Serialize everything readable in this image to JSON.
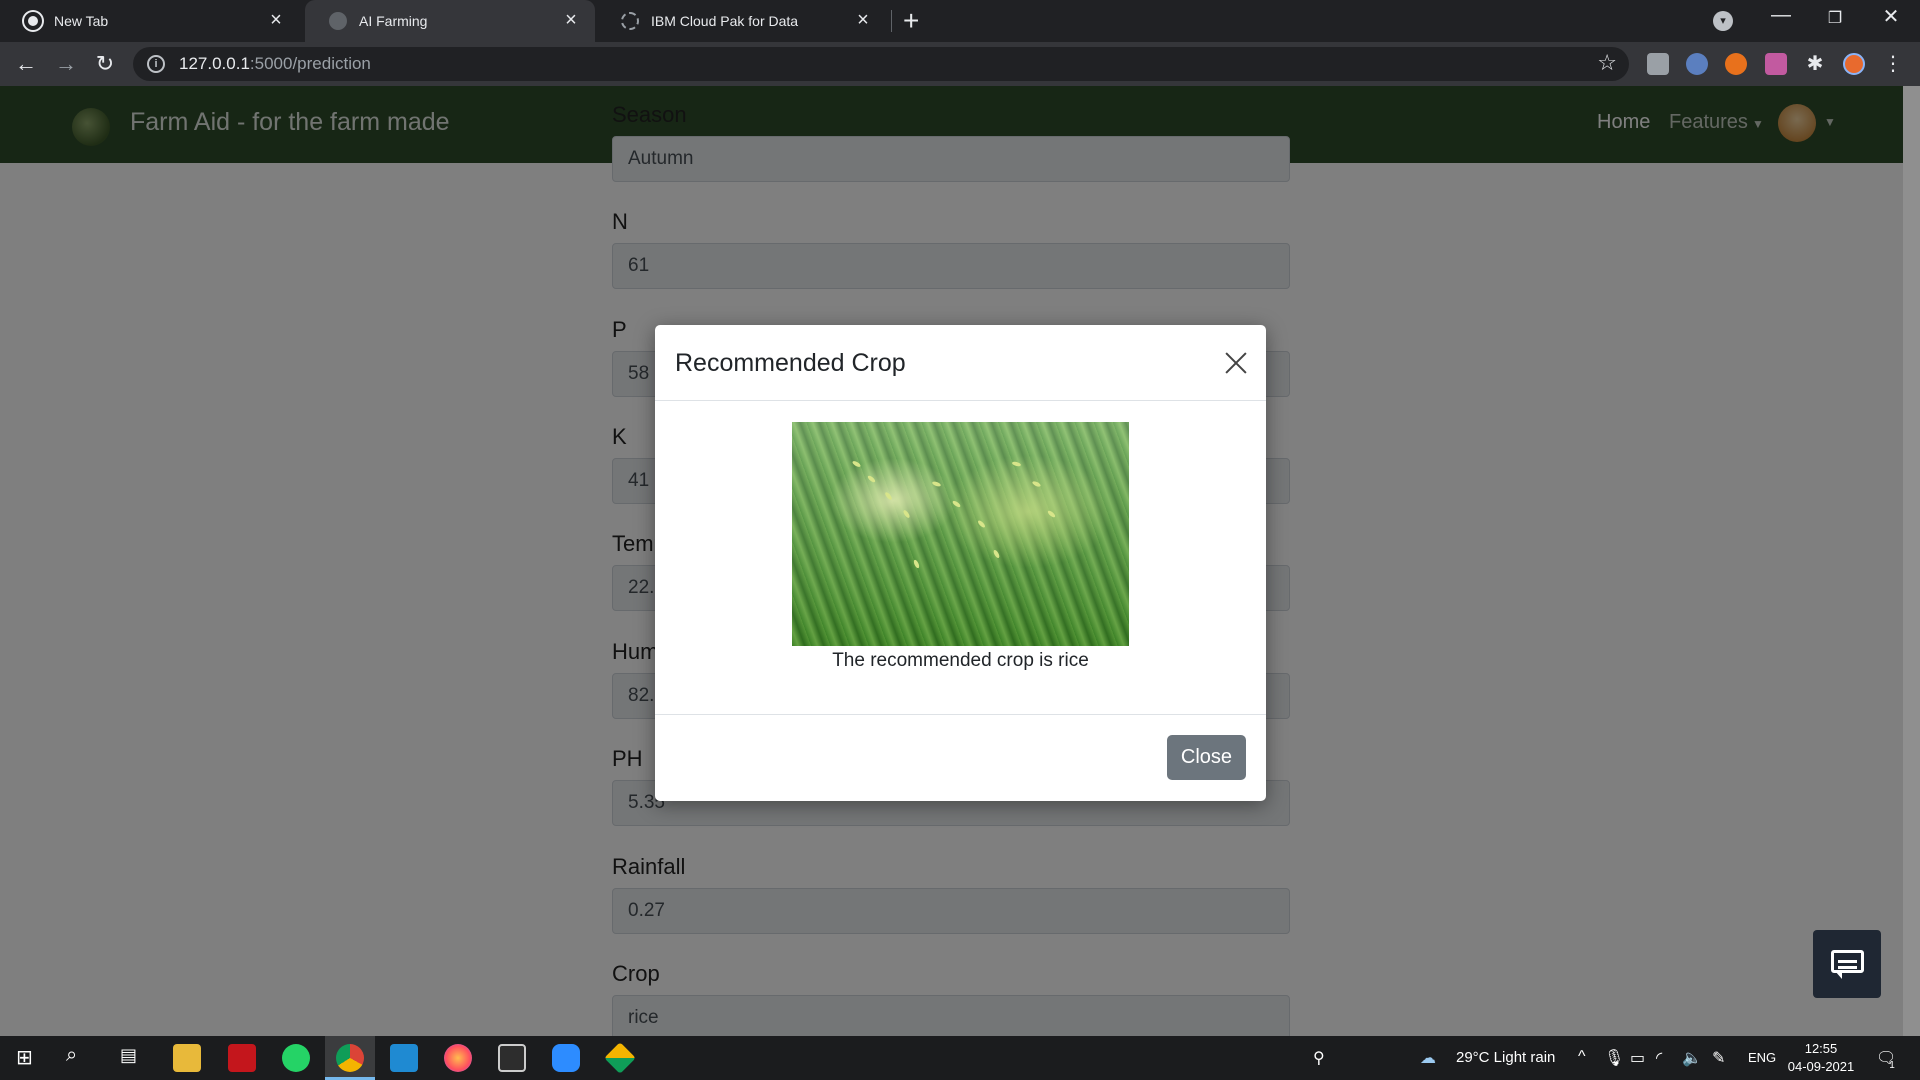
{
  "browser": {
    "tabs": [
      {
        "title": "New Tab",
        "icon": "chrome-icon",
        "active": false
      },
      {
        "title": "AI Farming",
        "icon": "globe-icon",
        "active": true
      },
      {
        "title": "IBM Cloud Pak for Data",
        "icon": "ibm-icon",
        "active": false
      }
    ],
    "url_host": "127.0.0.1",
    "url_path": ":5000/prediction"
  },
  "navbar": {
    "brand": "Farm Aid - for the farm made",
    "home": "Home",
    "features": "Features"
  },
  "form": [
    {
      "label": "Season",
      "value": "Autumn"
    },
    {
      "label": "N",
      "value": "61"
    },
    {
      "label": "P",
      "value": "58"
    },
    {
      "label": "K",
      "value": "41"
    },
    {
      "label": "Temp",
      "value": "22."
    },
    {
      "label": "Hum",
      "value": "82."
    },
    {
      "label": "PH",
      "value": "5.35"
    },
    {
      "label": "Rainfall",
      "value": "0.27"
    },
    {
      "label": "Crop",
      "value": "rice"
    }
  ],
  "modal": {
    "title": "Recommended Crop",
    "message": "The recommended crop is rice",
    "close_label": "Close",
    "image_subject": "rice-plant"
  },
  "taskbar": {
    "weather": "29°C  Light rain",
    "lang": "ENG",
    "time": "12:55",
    "date": "04-09-2021",
    "notifications": "1"
  },
  "colors": {
    "navbar": "#2f4d2a",
    "close_button": "#6c757d",
    "chat_button": "#1f2733"
  }
}
